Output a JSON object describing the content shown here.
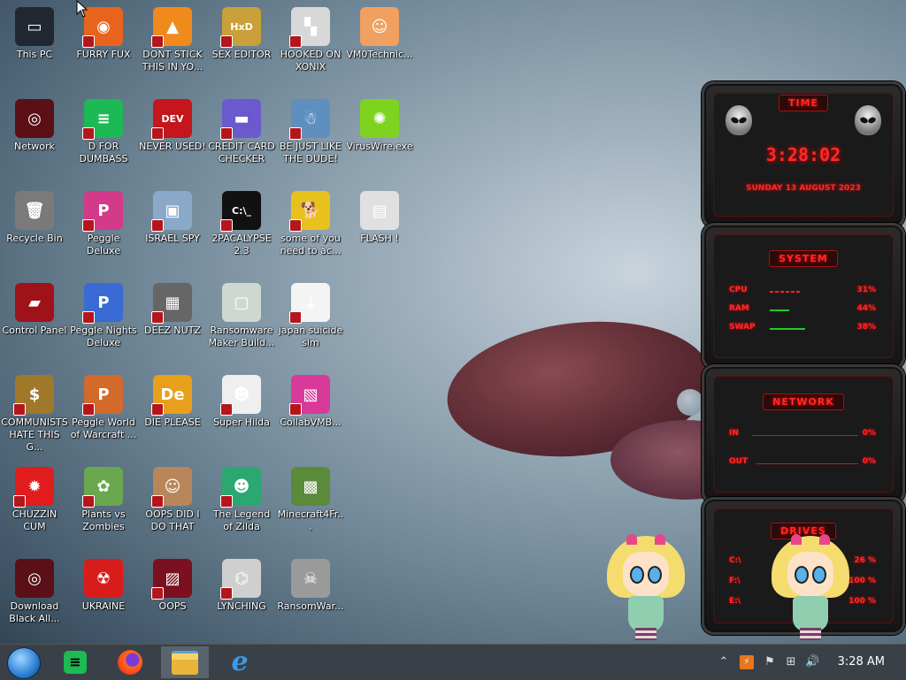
{
  "desktop_icons": [
    {
      "label": "This PC",
      "col": 0,
      "row": 0,
      "color": "#222831",
      "glyph": "▭",
      "badge": false
    },
    {
      "label": "FURRY FUX",
      "col": 1,
      "row": 0,
      "color": "#e8641c",
      "glyph": "◉",
      "badge": true
    },
    {
      "label": "DONT STICK THIS IN YO...",
      "col": 2,
      "row": 0,
      "color": "#f08a1c",
      "glyph": "▲",
      "badge": true
    },
    {
      "label": "SEX EDITOR",
      "col": 3,
      "row": 0,
      "color": "#c9a03a",
      "glyph": "HxD",
      "badge": true
    },
    {
      "label": "HOOKED ON XONIX",
      "col": 4,
      "row": 0,
      "color": "#d8d8d8",
      "glyph": "▚",
      "badge": true
    },
    {
      "label": "VM0Technic...",
      "col": 5,
      "row": 0,
      "color": "#f0a060",
      "glyph": "☺",
      "badge": false
    },
    {
      "label": "Network",
      "col": 0,
      "row": 1,
      "color": "#5a1016",
      "glyph": "◎",
      "badge": false
    },
    {
      "label": "D FOR DUMBASS",
      "col": 1,
      "row": 1,
      "color": "#1db954",
      "glyph": "≡",
      "badge": true
    },
    {
      "label": "NEVER USED!",
      "col": 2,
      "row": 1,
      "color": "#c4161c",
      "glyph": "DEV",
      "badge": true
    },
    {
      "label": "CREDIT CARD CHECKER",
      "col": 3,
      "row": 1,
      "color": "#6a5acd",
      "glyph": "▬",
      "badge": true
    },
    {
      "label": "BE JUST LIKE THE DUDE!",
      "col": 4,
      "row": 1,
      "color": "#5e8fbf",
      "glyph": "☃",
      "badge": true
    },
    {
      "label": "VirusWire.exe",
      "col": 5,
      "row": 1,
      "color": "#7ed321",
      "glyph": "✺",
      "badge": false
    },
    {
      "label": "Recycle Bin",
      "col": 0,
      "row": 2,
      "color": "#7a7a7a",
      "glyph": "🗑",
      "badge": false
    },
    {
      "label": "Peggle Deluxe",
      "col": 1,
      "row": 2,
      "color": "#d33a8a",
      "glyph": "P",
      "badge": true
    },
    {
      "label": "ISRAEL SPY",
      "col": 2,
      "row": 2,
      "color": "#8aa8c8",
      "glyph": "▣",
      "badge": true
    },
    {
      "label": "2PACALYPSE 2.3",
      "col": 3,
      "row": 2,
      "color": "#111111",
      "glyph": "C:\\_",
      "badge": true
    },
    {
      "label": "some of you need to ac...",
      "col": 4,
      "row": 2,
      "color": "#e8c21c",
      "glyph": "🐕",
      "badge": true
    },
    {
      "label": "FLASH !",
      "col": 5,
      "row": 2,
      "color": "#e0e0e0",
      "glyph": "▤",
      "badge": false
    },
    {
      "label": "Control Panel",
      "col": 0,
      "row": 3,
      "color": "#a0121a",
      "glyph": "▰",
      "badge": false
    },
    {
      "label": "Peggle Nights Deluxe",
      "col": 1,
      "row": 3,
      "color": "#3a6ad3",
      "glyph": "P",
      "badge": true
    },
    {
      "label": "DEEZ NUTZ",
      "col": 2,
      "row": 3,
      "color": "#666666",
      "glyph": "▦",
      "badge": true
    },
    {
      "label": "Ransomware Maker Build...",
      "col": 3,
      "row": 3,
      "color": "#cfd8d0",
      "glyph": "▢",
      "badge": false
    },
    {
      "label": "japan suicide sim",
      "col": 4,
      "row": 3,
      "color": "#f4f4f4",
      "glyph": "⇣",
      "badge": true
    },
    {
      "label": "COMMUNISTS HATE THIS G...",
      "col": 0,
      "row": 4,
      "color": "#a0782a",
      "glyph": "$",
      "badge": true
    },
    {
      "label": "Peggle World of Warcraft ...",
      "col": 1,
      "row": 4,
      "color": "#d36a2a",
      "glyph": "P",
      "badge": true
    },
    {
      "label": "DIE PLEASE",
      "col": 2,
      "row": 4,
      "color": "#e8a01c",
      "glyph": "De",
      "badge": true
    },
    {
      "label": "Super Hilda",
      "col": 3,
      "row": 4,
      "color": "#efefef",
      "glyph": "☻",
      "badge": true
    },
    {
      "label": "CollabVMB...",
      "col": 4,
      "row": 4,
      "color": "#d83a9a",
      "glyph": "▧",
      "badge": true
    },
    {
      "label": "CHUZZIN CUM",
      "col": 0,
      "row": 5,
      "color": "#e01c1c",
      "glyph": "✹",
      "badge": true
    },
    {
      "label": "Plants vs Zombies",
      "col": 1,
      "row": 5,
      "color": "#6aa84f",
      "glyph": "✿",
      "badge": true
    },
    {
      "label": "OOPS DID I DO THAT",
      "col": 2,
      "row": 5,
      "color": "#b8865a",
      "glyph": "☺",
      "badge": true
    },
    {
      "label": "The Legend of Zilda",
      "col": 3,
      "row": 5,
      "color": "#2aa870",
      "glyph": "☻",
      "badge": true
    },
    {
      "label": "Minecraft4Fr...",
      "col": 4,
      "row": 5,
      "color": "#5a8a3a",
      "glyph": "▩",
      "badge": false
    },
    {
      "label": "Download Black All...",
      "col": 0,
      "row": 6,
      "color": "#5a1016",
      "glyph": "◎",
      "badge": false
    },
    {
      "label": "UKRAINE",
      "col": 1,
      "row": 6,
      "color": "#d81c1c",
      "glyph": "☢",
      "badge": false
    },
    {
      "label": "OOPS",
      "col": 2,
      "row": 6,
      "color": "#7a1020",
      "glyph": "▨",
      "badge": true
    },
    {
      "label": "LYNCHING",
      "col": 3,
      "row": 6,
      "color": "#cfcfcf",
      "glyph": "⌬",
      "badge": true
    },
    {
      "label": "RansomWar...",
      "col": 4,
      "row": 6,
      "color": "#9a9a9a",
      "glyph": "☠",
      "badge": false
    }
  ],
  "widgets": {
    "time": {
      "title": "TIME",
      "clock": "3:28:02",
      "date": "SUNDAY 13 AUGUST 2023"
    },
    "system": {
      "title": "SYSTEM",
      "rows": [
        {
          "label": "CPU",
          "value": "31%",
          "bar": 0.31
        },
        {
          "label": "RAM",
          "value": "44%",
          "bar": 0.44
        },
        {
          "label": "SWAP",
          "value": "38%",
          "bar": 0.38
        }
      ]
    },
    "network": {
      "title": "NETWORK",
      "rows": [
        {
          "label": "IN",
          "value": "0%"
        },
        {
          "label": "OUT",
          "value": "0%"
        }
      ]
    },
    "drives": {
      "title": "DRIVES",
      "rows": [
        {
          "label": "C:\\",
          "value": "26 %"
        },
        {
          "label": "F:\\",
          "value": "100 %"
        },
        {
          "label": "E:\\",
          "value": "100 %"
        }
      ]
    }
  },
  "taskbar": {
    "apps": [
      {
        "name": "start-orb"
      },
      {
        "name": "spotify-app",
        "glyph": "≡",
        "color": "#1db954"
      },
      {
        "name": "firefox-app",
        "glyph": "◉",
        "color": "#e8641c"
      },
      {
        "name": "file-explorer-app",
        "glyph": "▭",
        "color": "#e8c24a",
        "active": true
      },
      {
        "name": "internet-explorer-app",
        "glyph": "e",
        "color": "#3a8ae8"
      }
    ],
    "clock": "3:28 AM"
  }
}
